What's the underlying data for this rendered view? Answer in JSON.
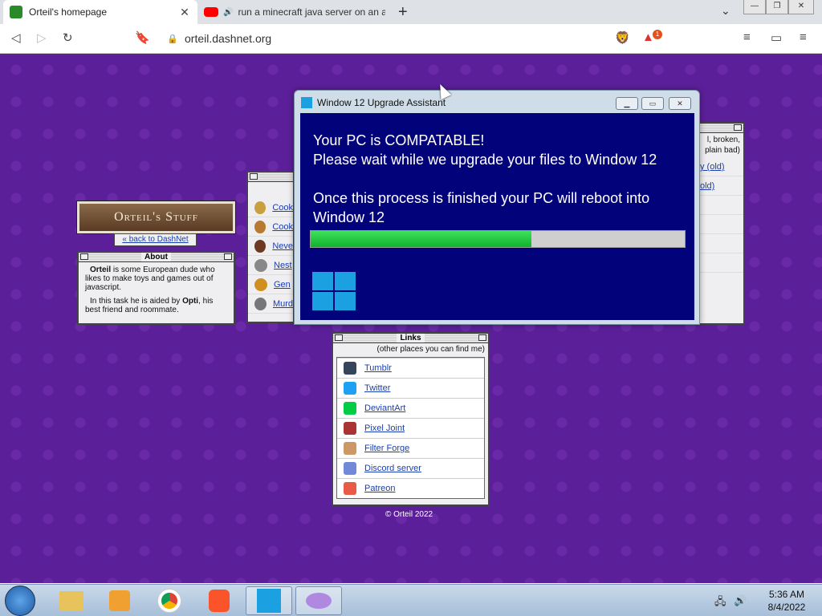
{
  "browser": {
    "tabs": [
      {
        "title": "Orteil's homepage",
        "active": true,
        "icon": "orteil-favicon"
      },
      {
        "title": "run a minecraft java server on an a",
        "active": false,
        "icon": "youtube-icon",
        "audio": true
      }
    ],
    "new_tab_glyph": "+",
    "url": "orteil.dashnet.org",
    "notification_count": "1"
  },
  "page": {
    "logo_text": "Orteil's Stuff",
    "back_link": "« back to DashNet",
    "about": {
      "title": "About",
      "p1_bold": "Orteil",
      "p1": " is some European dude who likes to make toys and games out of javascript.",
      "p2_pre": "In this task he is aided by ",
      "p2_bold": "Opti",
      "p2_post": ", his best friend and roommate."
    },
    "games": [
      {
        "label": "Cook",
        "color": "#c8a040"
      },
      {
        "label": "Cook",
        "color": "#b87a30"
      },
      {
        "label": "Neve",
        "color": "#6b3a20"
      },
      {
        "label": "Nest",
        "color": "#888"
      },
      {
        "label": "Gen",
        "color": "#d09020"
      },
      {
        "label": "Murd",
        "color": "#777"
      }
    ],
    "right_panel": {
      "text_lines": [
        "l, broken,",
        "plain bad)"
      ],
      "items": [
        "y (old)",
        "old)"
      ]
    },
    "links": {
      "title": "Links",
      "subtitle": "(other places you can find me)",
      "items": [
        {
          "label": "Tumblr",
          "icon": "tumblr-icon",
          "color": "#35465c"
        },
        {
          "label": "Twitter",
          "icon": "twitter-icon",
          "color": "#1da1f2"
        },
        {
          "label": "DeviantArt",
          "icon": "deviantart-icon",
          "color": "#05cc47"
        },
        {
          "label": "Pixel Joint",
          "icon": "pixel-joint-icon",
          "color": "#a33"
        },
        {
          "label": "Filter Forge",
          "icon": "filter-forge-icon",
          "color": "#c96"
        },
        {
          "label": "Discord server",
          "icon": "discord-icon",
          "color": "#7289da"
        },
        {
          "label": "Patreon",
          "icon": "patreon-icon",
          "color": "#e85b46"
        }
      ]
    },
    "copyright": "© Orteil 2022"
  },
  "popup": {
    "title": "Window 12 Upgrade Assistant",
    "line1": "Your PC is COMPATABLE!",
    "line2": "Please wait while we upgrade your files to Window 12",
    "line3": "Once this process is finished your PC will reboot into Window 12",
    "progress": 0.59
  },
  "taskbar": {
    "apps": [
      "windows-explorer-icon",
      "media-player-icon",
      "chrome-icon",
      "brave-icon",
      "window-12-icon",
      "dolphin-icon"
    ],
    "time": "5:36 AM",
    "date": "8/4/2022"
  }
}
